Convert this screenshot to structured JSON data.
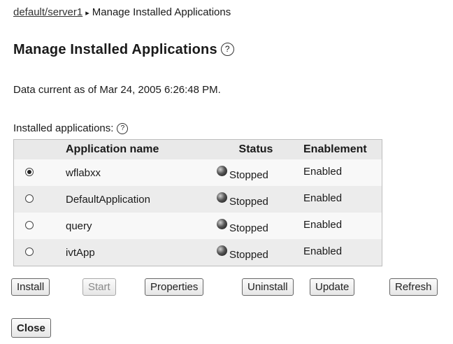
{
  "breadcrumb": {
    "link": "default/server1",
    "separator": "▸",
    "current": "Manage Installed Applications"
  },
  "page": {
    "title": "Manage Installed Applications",
    "help_glyph": "?",
    "data_current": "Data current as of Mar 24, 2005 6:26:48 PM.",
    "installed_label": "Installed applications:"
  },
  "table": {
    "headers": {
      "name": "Application name",
      "status": "Status",
      "enablement": "Enablement"
    },
    "rows": [
      {
        "name": "wflabxx",
        "status": "Stopped",
        "enablement": "Enabled",
        "selected": true
      },
      {
        "name": "DefaultApplication",
        "status": "Stopped",
        "enablement": "Enabled",
        "selected": false
      },
      {
        "name": "query",
        "status": "Stopped",
        "enablement": "Enabled",
        "selected": false
      },
      {
        "name": "ivtApp",
        "status": "Stopped",
        "enablement": "Enabled",
        "selected": false
      }
    ]
  },
  "buttons": {
    "install": "Install",
    "start": "Start",
    "properties": "Properties",
    "uninstall": "Uninstall",
    "update": "Update",
    "refresh": "Refresh",
    "close": "Close"
  },
  "icons": {
    "help": "help-icon",
    "status": "stopped-status-icon"
  }
}
